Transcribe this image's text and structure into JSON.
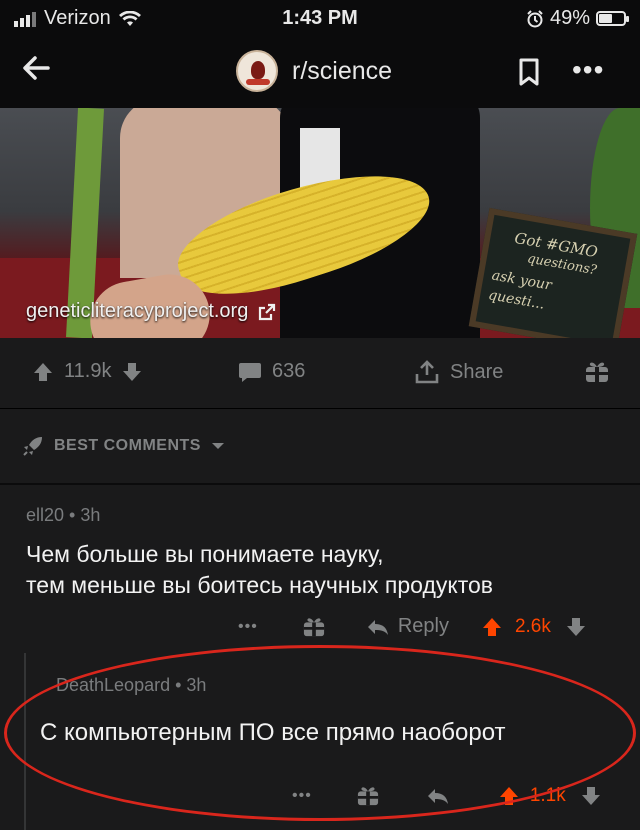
{
  "status": {
    "carrier": "Verizon",
    "time": "1:43 PM",
    "battery": "49%",
    "battery_level": 0.49
  },
  "nav": {
    "subreddit": "r/science"
  },
  "post": {
    "link": "geneticliteracyproject.org",
    "sign_lines": [
      "Got #GMO",
      "questions?",
      "ask your",
      "questi..."
    ],
    "upvotes": "11.9k",
    "comments": "636",
    "share": "Share"
  },
  "sort": {
    "label": "BEST COMMENTS"
  },
  "comments": [
    {
      "author": "ell20",
      "age": "3h",
      "text_line1": "Чем больше вы понимаете науку,",
      "text_line2": "тем меньше вы боитесь научных продуктов",
      "reply": "Reply",
      "score": "2.6k"
    },
    {
      "author": "DeathLeopard",
      "age": "3h",
      "text": "С компьютерным ПО все прямо наоборот",
      "score": "1.1k"
    }
  ],
  "colors": {
    "background": "#1a1a1b",
    "upvote": "#ff4500",
    "annotation": "#d9261c"
  },
  "icons": [
    "back-arrow-icon",
    "bookmark-icon",
    "more-icon",
    "external-link-icon",
    "upvote-icon",
    "downvote-icon",
    "comment-icon",
    "share-icon",
    "award-icon",
    "rocket-icon",
    "chevron-down-icon",
    "reply-icon"
  ]
}
